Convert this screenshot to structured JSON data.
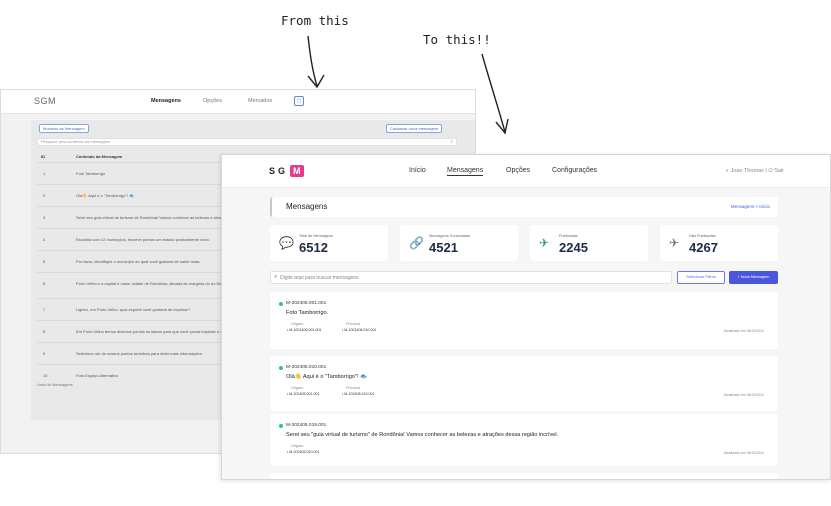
{
  "annotations": {
    "from": "From this",
    "to": "To this!!"
  },
  "old_ui": {
    "brand": "SGM",
    "nav": [
      "Mensagens",
      "Opções",
      "Mercados"
    ],
    "buttons": {
      "templates": "Modelos de Mensagem",
      "register": "Cadastrar nova mensagem"
    },
    "search_placeholder": "Pesquise pelo conteúdo da mensagem",
    "columns": [
      "ID",
      "Conteúdo da Mensagem"
    ],
    "rows": [
      {
        "id": "1",
        "text": "Foto Tamborrigo"
      },
      {
        "id": "2",
        "text": "Olá👋 Aqui é o \"Tamborrigo\"! 🐟"
      },
      {
        "id": "3",
        "text": "Serei seu guia virtual de turismo de Rondônia! Vamos conhecer as belezas e atraçõ"
      },
      {
        "id": "4",
        "text": "Escolhia com 12 municípios, escreve pontos um estado praticamente novo."
      },
      {
        "id": "5",
        "text": "Por favor, identifique o município do qual você gostaria de saber mais:"
      },
      {
        "id": "6",
        "text": "Porto Velho é a capital e maior cidade de Rondônia, situada às margens do rio Madeira"
      },
      {
        "id": "7",
        "text": "Ligeiro, em Porto Velho: qual esporte você gostaria de explorar?"
      },
      {
        "id": "8",
        "text": "Em Porto Velho temos diversos pontos turísticos para que você possa explorar e conhecer"
      },
      {
        "id": "9",
        "text": "Selecione um de nossos pontos turísticos para obter mais informações."
      },
      {
        "id": "10",
        "text": "Foto Espaço Alternativo"
      }
    ],
    "footer": "Lista de Mensagens"
  },
  "new_ui": {
    "logo": "SG",
    "logo_badge": "M",
    "nav": [
      "Início",
      "Mensagens",
      "Opções",
      "Configurações"
    ],
    "user": "◐  Joao Thomas  |  ⏻ Sair",
    "page_title": "Mensagens",
    "breadcrumb": "Mensagens > Início",
    "stats": [
      {
        "label": "Total de Mensagens",
        "value": "6512",
        "icon": "💬"
      },
      {
        "label": "Mensagens Conectadas",
        "value": "4521",
        "icon": "🔗"
      },
      {
        "label": "Publicadas",
        "value": "2245",
        "icon": "✈"
      },
      {
        "label": "Não Publicadas",
        "value": "4267",
        "icon": "✈"
      }
    ],
    "search_placeholder": "Digite aqui para buscar mensagens",
    "filter_button": "Selecionar Filtros",
    "new_button": "+ Nova Mensagem",
    "messages": [
      {
        "code": "M-202405.001.001",
        "body": "Foto Tamborrigo.",
        "origin_label": "Origem",
        "origin": "M-1001406.001.001",
        "next_label": "Próxima",
        "next": "M-1001406.010.001",
        "updated": "Atualizado em 06/11/2024"
      },
      {
        "code": "M-202405.010.001",
        "body": "Olá👋 Aqui é o \"Tamborrigo\"! 🐟",
        "origin_label": "Origem",
        "origin": "M-202405.001.001",
        "next_label": "Próxima",
        "next": "M-202405.019.001",
        "updated": "Atualizado em 06/11/2024"
      },
      {
        "code": "M-202405.019.001",
        "body": "Serei seu \"guia virtual de turismo\" de Rondônia! Vamos conhecer as belezas e atrações dessa região incrível.",
        "origin_label": "Origem",
        "origin": "M-202405.010.001",
        "updated": "Atualizado em 06/11/2024"
      }
    ]
  }
}
